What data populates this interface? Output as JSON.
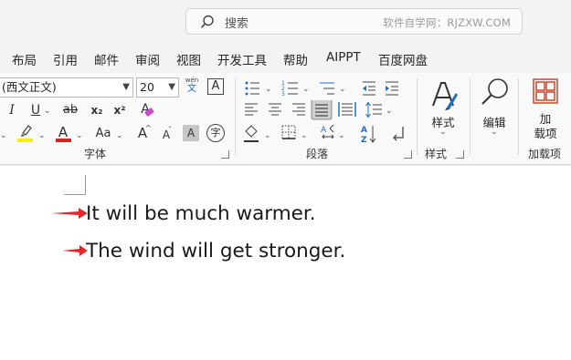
{
  "search": {
    "placeholder": "搜索",
    "watermark": "软件自学网：RJZXW.COM",
    "icon": "search-icon"
  },
  "menu": {
    "tabs": [
      "布局",
      "引用",
      "邮件",
      "审阅",
      "视图",
      "开发工具",
      "帮助",
      "AIPPT",
      "百度网盘"
    ]
  },
  "ribbon": {
    "font": {
      "font_name": "(西文正文)",
      "font_size": "20",
      "phonetic_top": "wén",
      "phonetic_bottom": "文",
      "border_char": "A",
      "italic": "I",
      "underline": "U",
      "strike": "ab",
      "subscript": "x₂",
      "superscript": "x²",
      "clear_format": "A",
      "font_color_glyph": "A",
      "case_label": "Aa",
      "grow_font": "A",
      "shrink_font": "A",
      "shading_char": "A",
      "enclosed_char": "字",
      "highlight_color": "#f6f000",
      "font_color": "#e0201f",
      "group_label": "字体"
    },
    "paragraph": {
      "group_label": "段落",
      "sort_label": "A Z"
    },
    "styles": {
      "button_label": "样式",
      "group_label": "样式"
    },
    "editing": {
      "button_label": "编辑"
    },
    "addins": {
      "button_label_1": "加",
      "button_label_2": "载项",
      "group_label": "加载项",
      "accent": "#c8492d"
    }
  },
  "document": {
    "lines": [
      "It will be much warmer.",
      "The wind will get stronger."
    ],
    "arrow_color": "#e8262a"
  }
}
